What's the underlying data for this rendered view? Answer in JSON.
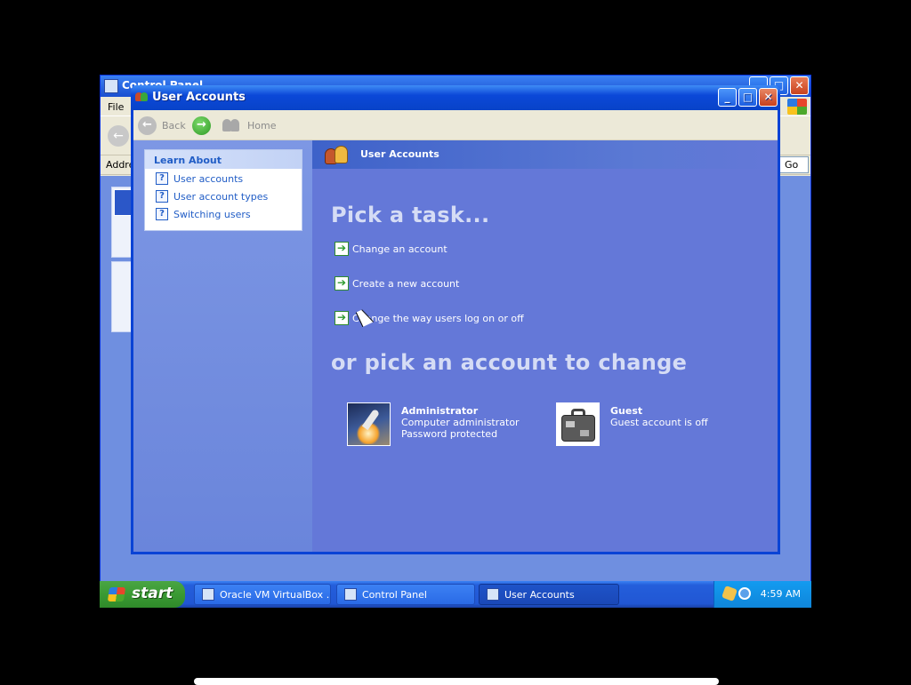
{
  "control_panel": {
    "title": "Control Panel",
    "menu_file": "File",
    "address_label": "Address",
    "go_label": "Go"
  },
  "user_accounts": {
    "title": "User Accounts",
    "toolbar": {
      "back_label": "Back",
      "home_label": "Home"
    },
    "learn_about": {
      "header": "Learn About",
      "items": [
        {
          "label": "User accounts"
        },
        {
          "label": "User account types"
        },
        {
          "label": "Switching users"
        }
      ]
    },
    "header_title": "User Accounts",
    "pick_task_heading": "Pick a task...",
    "tasks": [
      {
        "label": "Change an account"
      },
      {
        "label": "Create a new account"
      },
      {
        "label": "Change the way users log on or off"
      }
    ],
    "pick_account_heading": "or pick an account to change",
    "accounts": [
      {
        "name": "Administrator",
        "line1": "Computer administrator",
        "line2": "Password protected"
      },
      {
        "name": "Guest",
        "line1": "Guest account is off",
        "line2": ""
      }
    ]
  },
  "taskbar": {
    "start_label": "start",
    "buttons": [
      {
        "label": "Oracle VM VirtualBox ...",
        "active": false
      },
      {
        "label": "Control Panel",
        "active": false
      },
      {
        "label": "User Accounts",
        "active": true
      }
    ],
    "clock": "4:59 AM"
  },
  "icons": {
    "back": "arrow-left-icon",
    "forward": "arrow-right-icon",
    "home": "users-home-icon",
    "help": "question-icon",
    "task_arrow": "green-arrow-icon"
  },
  "colors": {
    "titlebar": "#0a43d5",
    "pane_blue": "#6478d8",
    "link_blue": "#215dc6",
    "start_green": "#3a9a33"
  }
}
